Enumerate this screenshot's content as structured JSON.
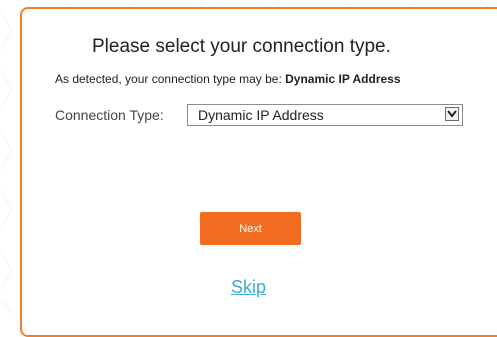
{
  "dialog": {
    "title": "Please select your connection type.",
    "detected_prefix": "As detected, your connection type may be: ",
    "detected_value": "Dynamic IP Address"
  },
  "form": {
    "connection_label": "Connection Type:",
    "connection_selected": "Dynamic IP Address"
  },
  "actions": {
    "next_label": "Next",
    "skip_label": "Skip"
  },
  "colors": {
    "accent": "#f26c21",
    "border": "#f07f2c",
    "link": "#3fa9d8"
  },
  "icons": {
    "select_arrow": "chevron-down-icon"
  }
}
